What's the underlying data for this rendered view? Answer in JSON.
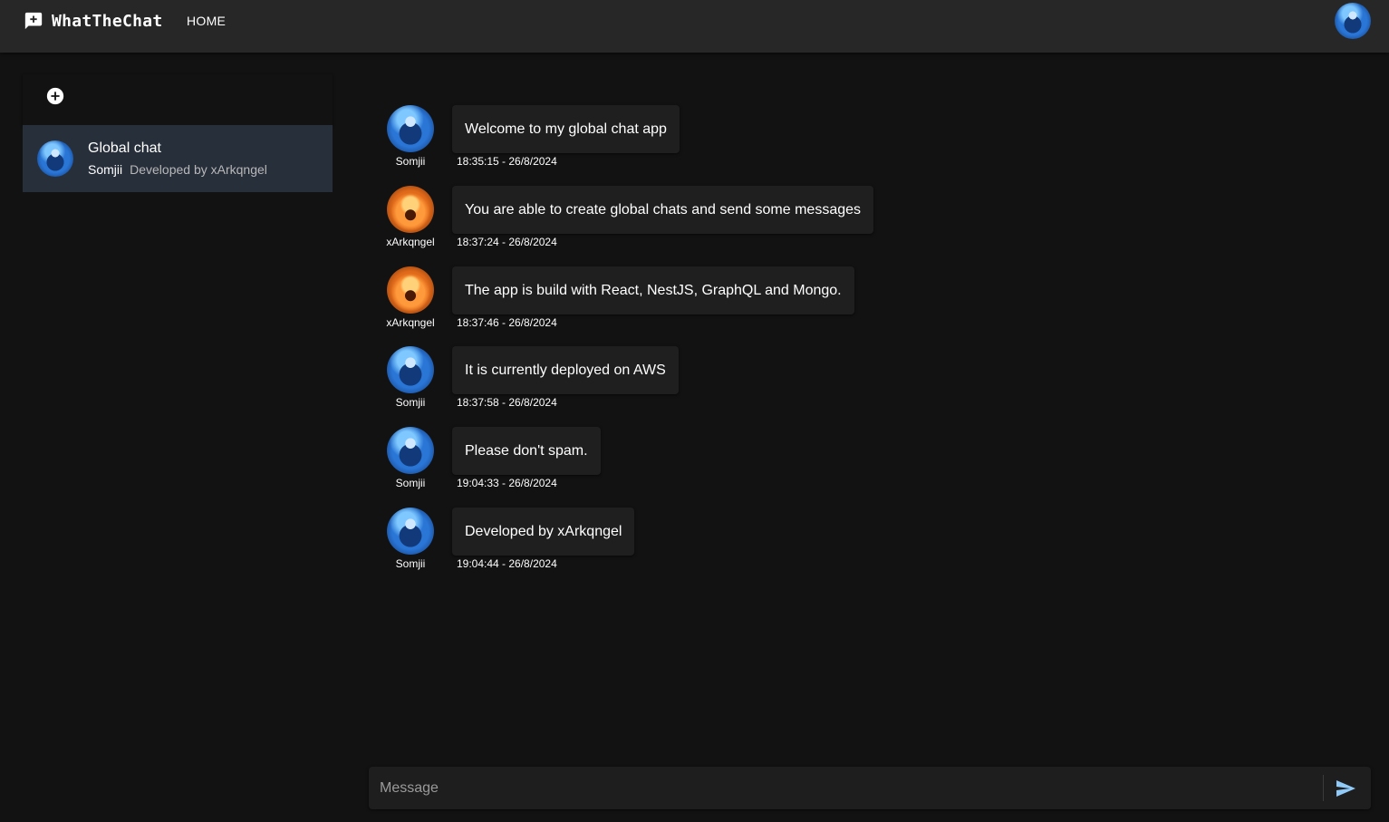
{
  "appbar": {
    "brand_name": "WhatTheChat",
    "brand_icon": "chat-add-icon",
    "nav_home": "HOME",
    "user_avatar_color": "blue"
  },
  "sidebar": {
    "add_icon": "add-circle-icon",
    "chats": [
      {
        "title": "Global chat",
        "last_author": "Somjii",
        "last_message": "Developed by xArkqngel",
        "selected": true
      }
    ]
  },
  "messages": [
    {
      "user": "Somjii",
      "avatar": "blue",
      "text": "Welcome to my global chat app",
      "time": "18:35:15 - 26/8/2024"
    },
    {
      "user": "xArkqngel",
      "avatar": "orange",
      "text": "You are able to create global chats and send some messages",
      "time": "18:37:24 - 26/8/2024"
    },
    {
      "user": "xArkqngel",
      "avatar": "orange",
      "text": "The app is build with React, NestJS, GraphQL and Mongo.",
      "time": "18:37:46 - 26/8/2024"
    },
    {
      "user": "Somjii",
      "avatar": "blue",
      "text": "It is currently deployed on AWS",
      "time": "18:37:58 - 26/8/2024"
    },
    {
      "user": "Somjii",
      "avatar": "blue",
      "text": "Please don't spam.",
      "time": "19:04:33 - 26/8/2024"
    },
    {
      "user": "Somjii",
      "avatar": "blue",
      "text": "Developed by xArkqngel",
      "time": "19:04:44 - 26/8/2024"
    }
  ],
  "composer": {
    "placeholder": "Message",
    "value": "",
    "send_icon": "send-icon",
    "send_icon_color": "#90caf9"
  },
  "colors": {
    "background": "#121212",
    "appbar": "#272727",
    "selected_chat": "#272f3b",
    "bubble": "#1f1f1f",
    "accent": "#90caf9"
  }
}
